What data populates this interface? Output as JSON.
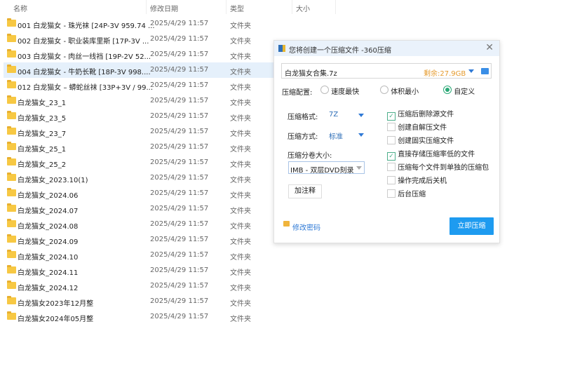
{
  "columns": {
    "name": "名称",
    "date": "修改日期",
    "type": "类型",
    "size": "大小"
  },
  "rows": [
    {
      "name": "001 白龙猫女 - 珠光袜 [24P-3V 959.74 ...",
      "date": "2025/4/29 11:57",
      "type": "文件夹"
    },
    {
      "name": "002 白龙猫女 - 职业装库里斯 [17P-3V ...",
      "date": "2025/4/29 11:57",
      "type": "文件夹"
    },
    {
      "name": "003 白龙猫女 - 肉丝一线裆 [19P-2V 52...",
      "date": "2025/4/29 11:57",
      "type": "文件夹"
    },
    {
      "name": "004 白龙猫女 - 牛奶长靴 [18P-3V 998....",
      "date": "2025/4/29 11:57",
      "type": "文件夹",
      "selected": true
    },
    {
      "name": "012 白龙猫女 – 蟒蛇丝袜 [33P+3V / 99...",
      "date": "2025/4/29 11:57",
      "type": "文件夹"
    },
    {
      "name": "白龙猫女_23_1",
      "date": "2025/4/29 11:57",
      "type": "文件夹"
    },
    {
      "name": "白龙猫女_23_5",
      "date": "2025/4/29 11:57",
      "type": "文件夹"
    },
    {
      "name": "白龙猫女_23_7",
      "date": "2025/4/29 11:57",
      "type": "文件夹"
    },
    {
      "name": "白龙猫女_25_1",
      "date": "2025/4/29 11:57",
      "type": "文件夹"
    },
    {
      "name": "白龙猫女_25_2",
      "date": "2025/4/29 11:57",
      "type": "文件夹"
    },
    {
      "name": "白龙猫女_2023.10(1)",
      "date": "2025/4/29 11:57",
      "type": "文件夹"
    },
    {
      "name": "白龙猫女_2024.06",
      "date": "2025/4/29 11:57",
      "type": "文件夹"
    },
    {
      "name": "白龙猫女_2024.07",
      "date": "2025/4/29 11:57",
      "type": "文件夹"
    },
    {
      "name": "白龙猫女_2024.08",
      "date": "2025/4/29 11:57",
      "type": "文件夹"
    },
    {
      "name": "白龙猫女_2024.09",
      "date": "2025/4/29 11:57",
      "type": "文件夹"
    },
    {
      "name": "白龙猫女_2024.10",
      "date": "2025/4/29 11:57",
      "type": "文件夹"
    },
    {
      "name": "白龙猫女_2024.11",
      "date": "2025/4/29 11:57",
      "type": "文件夹"
    },
    {
      "name": "白龙猫女_2024.12",
      "date": "2025/4/29 11:57",
      "type": "文件夹"
    },
    {
      "name": "白龙猫女2023年12月整",
      "date": "2025/4/29 11:57",
      "type": "文件夹"
    },
    {
      "name": "白龙猫女2024年05月整",
      "date": "2025/4/29 11:57",
      "type": "文件夹"
    }
  ],
  "dialog": {
    "title": "您将创建一个压缩文件 -360压缩",
    "filename": "白龙猫女合集.7z",
    "free_space": "剩余:27.9GB",
    "profile_label": "压缩配置:",
    "profiles": [
      "速度最快",
      "体积最小",
      "自定义"
    ],
    "profile_selected": "自定义",
    "format_label": "压缩格式:",
    "format_value": "7Z",
    "method_label": "压缩方式:",
    "method_value": "标准",
    "volume_label": "压缩分卷大小:",
    "volume_value": "IMB  - 双层DVD刻录",
    "comment_button": "加注释",
    "password_link": "修改密码",
    "submit_button": "立即压缩",
    "options": [
      {
        "label": "压缩后删除源文件",
        "checked": true
      },
      {
        "label": "创建自解压文件",
        "checked": false
      },
      {
        "label": "创建固实压缩文件",
        "checked": false
      },
      {
        "label": "直接存储压缩率低的文件",
        "checked": true
      },
      {
        "label": "压缩每个文件到单独的压缩包",
        "checked": false
      },
      {
        "label": "操作完成后关机",
        "checked": false
      },
      {
        "label": "后台压缩",
        "checked": false
      }
    ],
    "colors": {
      "accent": "#1e9bf0",
      "free_space": "#e59a2c",
      "radio": "#2aa876"
    }
  }
}
